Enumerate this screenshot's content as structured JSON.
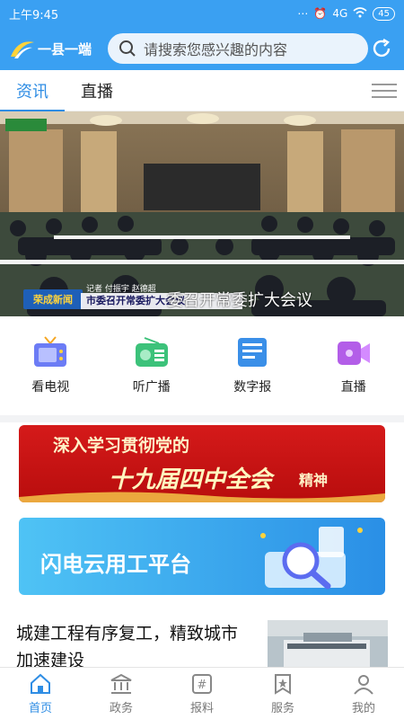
{
  "status_bar": {
    "time": "上午9:45",
    "battery": "45",
    "signal": "4G"
  },
  "header": {
    "logo_text": "一县一端",
    "search_placeholder": "请搜索您感兴趣的内容"
  },
  "tabs": [
    {
      "label": "资讯",
      "active": true
    },
    {
      "label": "直播",
      "active": false
    }
  ],
  "hero": {
    "caption": "委召开常委扩大会议",
    "ticker_logo": "荣成新闻",
    "ticker_meta": "记者 付振宇 赵德超",
    "ticker_text": "市委召开常委扩大会议"
  },
  "quick_access": [
    {
      "label": "看电视",
      "icon": "tv-icon"
    },
    {
      "label": "听广播",
      "icon": "radio-icon"
    },
    {
      "label": "数字报",
      "icon": "newspaper-icon"
    },
    {
      "label": "直播",
      "icon": "video-icon"
    }
  ],
  "banners": {
    "red": {
      "line1": "深入学习贯彻党的",
      "line2": "十九届四中全会",
      "line3": "精神"
    },
    "blue": {
      "text": "闪电云用工平台"
    }
  },
  "news": [
    {
      "title": "城建工程有序复工，精致城市加速建设"
    }
  ],
  "bottom_nav": [
    {
      "label": "首页",
      "icon": "home-icon",
      "active": true
    },
    {
      "label": "政务",
      "icon": "government-icon",
      "active": false
    },
    {
      "label": "报料",
      "icon": "hashtag-icon",
      "active": false
    },
    {
      "label": "服务",
      "icon": "service-icon",
      "active": false
    },
    {
      "label": "我的",
      "icon": "user-icon",
      "active": false
    }
  ],
  "colors": {
    "primary": "#3aa0f2",
    "active_tab": "#2f8de4",
    "banner_red": "#c81212"
  }
}
